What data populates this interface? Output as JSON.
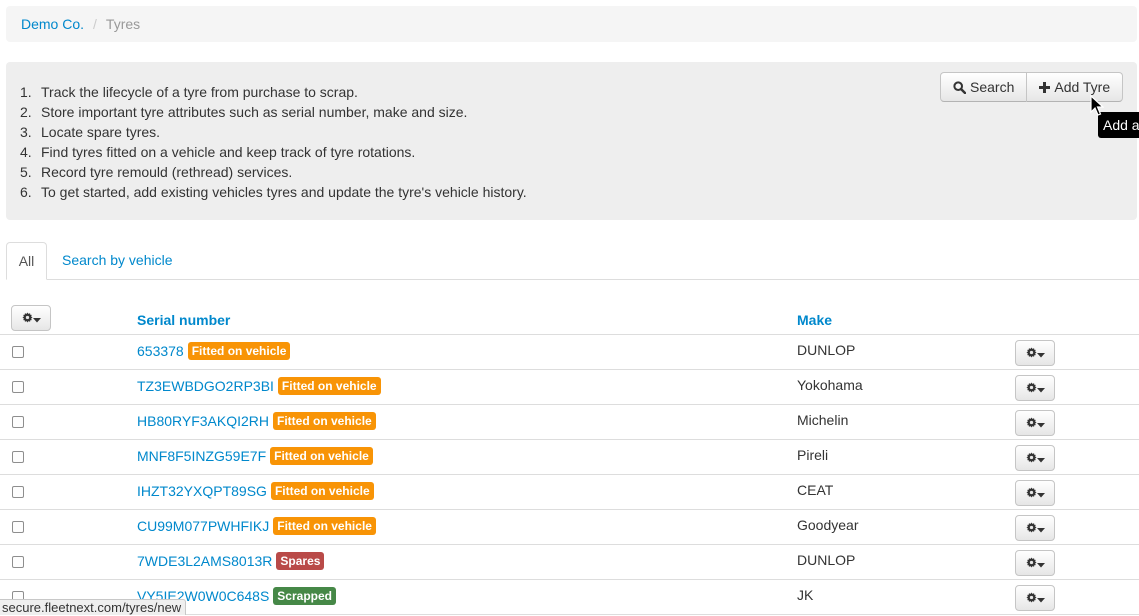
{
  "breadcrumb": {
    "home": "Demo Co.",
    "separator": "/",
    "current": "Tyres"
  },
  "intro": {
    "items": [
      {
        "num": "1.",
        "text": "Track the lifecycle of a tyre from purchase to scrap."
      },
      {
        "num": "2.",
        "text": "Store important tyre attributes such as serial number, make and size."
      },
      {
        "num": "3.",
        "text": "Locate spare tyres."
      },
      {
        "num": "4.",
        "text": "Find tyres fitted on a vehicle and keep track of tyre rotations."
      },
      {
        "num": "5.",
        "text": "Record tyre remould (rethread) services."
      },
      {
        "num": "6.",
        "text": "To get started, add existing vehicles tyres and update the tyre's vehicle history."
      }
    ]
  },
  "toolbar": {
    "search_label": "Search",
    "add_label": "Add Tyre",
    "tooltip": "Add a"
  },
  "tabs": {
    "all": "All",
    "by_vehicle": "Search by vehicle"
  },
  "table": {
    "columns": {
      "serial": "Serial number",
      "make": "Make"
    },
    "rows": [
      {
        "serial": "653378",
        "status": "Fitted on vehicle",
        "make": "DUNLOP"
      },
      {
        "serial": "TZ3EWBDGO2RP3BI",
        "status": "Fitted on vehicle",
        "make": "Yokohama"
      },
      {
        "serial": "HB80RYF3AKQI2RH",
        "status": "Fitted on vehicle",
        "make": "Michelin"
      },
      {
        "serial": "MNF8F5INZG59E7F",
        "status": "Fitted on vehicle",
        "make": "Pireli"
      },
      {
        "serial": "IHZT32YXQPT89SG",
        "status": "Fitted on vehicle",
        "make": "CEAT"
      },
      {
        "serial": "CU99M077PWHFIKJ",
        "status": "Fitted on vehicle",
        "make": "Goodyear"
      },
      {
        "serial": "7WDE3L2AMS8013R",
        "status": "Spares",
        "make": "DUNLOP"
      },
      {
        "serial": "VY5IE2W0W0C648S",
        "status": "Scrapped",
        "make": "JK"
      }
    ]
  },
  "status_colors": {
    "fitted": "#f89406",
    "spares": "#b94a48",
    "scrapped": "#468847"
  },
  "statusbar": {
    "url": "secure.fleetnext.com/tyres/new"
  },
  "icons": {
    "search": "search-icon",
    "add": "plus-icon",
    "gear": "gear-icon",
    "caret": "caret-down-icon"
  }
}
